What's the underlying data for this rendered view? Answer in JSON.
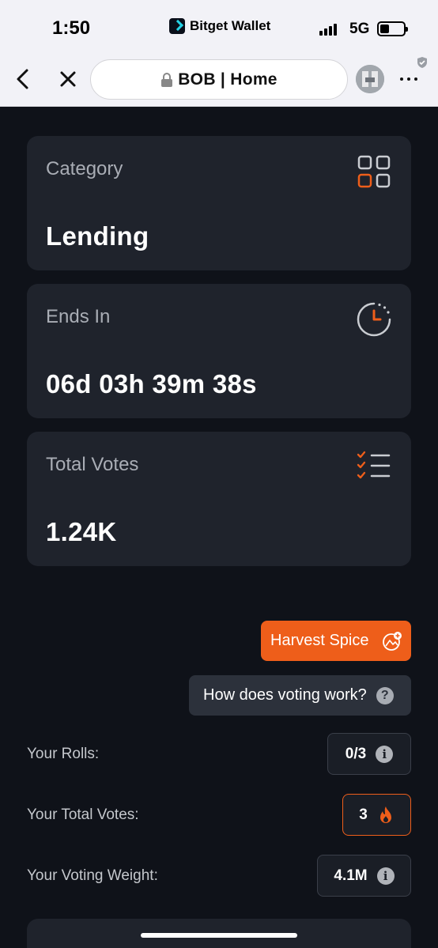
{
  "status_bar": {
    "time": "1:50",
    "app_name": "Bitget Wallet",
    "network": "5G"
  },
  "browser": {
    "url_title": "BOB | Home"
  },
  "cards": [
    {
      "title": "Category",
      "value": "Lending",
      "icon": "grid-icon"
    },
    {
      "title": "Ends In",
      "value": "06d 03h 39m 38s",
      "icon": "timer-icon"
    },
    {
      "title": "Total Votes",
      "value": "1.24K",
      "icon": "checklist-icon"
    }
  ],
  "actions": {
    "harvest_label": "Harvest Spice",
    "howto_label": "How does voting work?",
    "howto_icon_glyph": "?"
  },
  "stats": {
    "rolls_label": "Your Rolls:",
    "rolls_value": "0/3",
    "total_votes_label": "Your Total Votes:",
    "total_votes_value": "3",
    "weight_label": "Your Voting Weight:",
    "weight_value": "4.1M",
    "info_glyph": "i"
  },
  "colors": {
    "accent": "#ee5e1a",
    "background": "#0f1219",
    "card": "#1f232c"
  }
}
